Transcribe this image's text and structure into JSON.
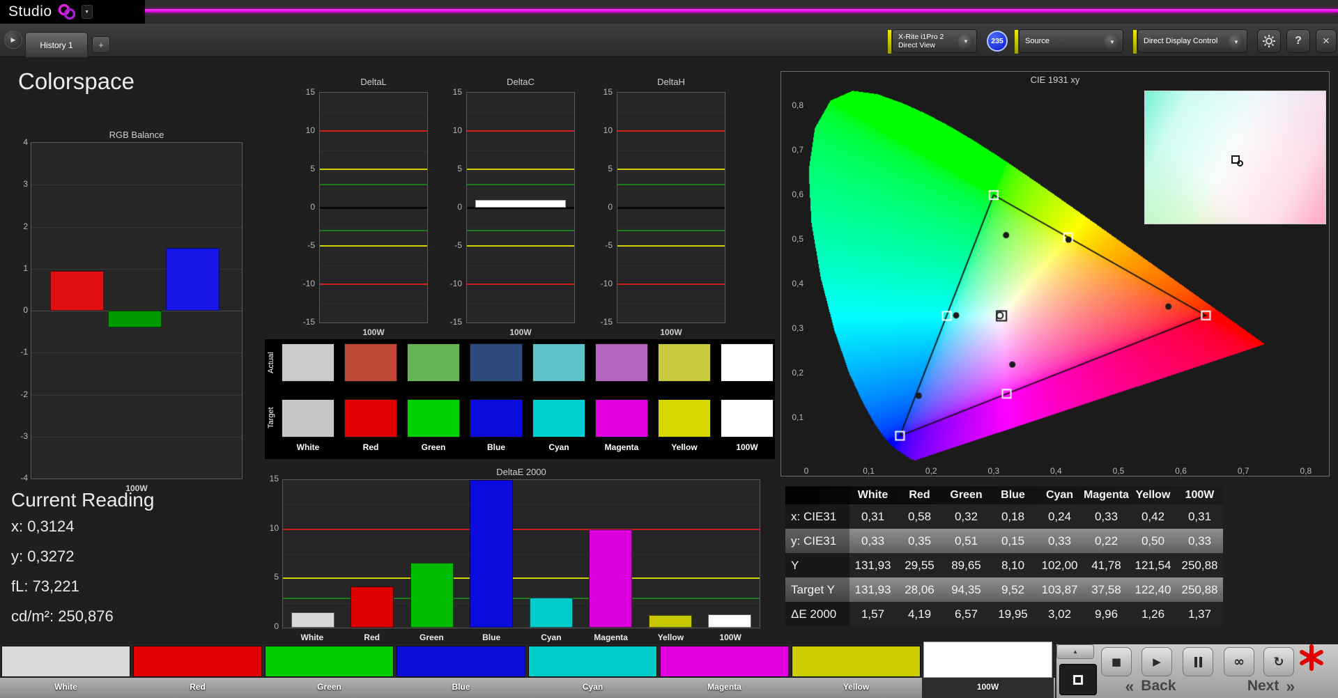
{
  "app": {
    "logo_text": "Studio",
    "accent_color": "#ff00ff"
  },
  "icons": {
    "dropdown_arrow": "▼",
    "expander": "▶",
    "caret": "▼",
    "add": "+",
    "close": "×",
    "help": "?",
    "up": "▲",
    "stop": "■",
    "play": "▶",
    "infinity": "∞",
    "refresh": "↻"
  },
  "tabbar": {
    "history_tab": "History 1"
  },
  "toolbar": {
    "meter_line1": "X-Rite i1Pro 2",
    "meter_line2": "Direct View",
    "meter_badge": "235",
    "source": "Source",
    "display_control": "Direct Display Control"
  },
  "page": {
    "title": "Colorspace"
  },
  "current_reading": {
    "title": "Current Reading",
    "lines": [
      "x: 0,3124",
      "y: 0,3272",
      "fL: 73,221",
      "cd/m²: 250,876"
    ]
  },
  "swatches": {
    "row_labels": [
      "Actual",
      "Target"
    ],
    "column_labels": [
      "White",
      "Red",
      "Green",
      "Blue",
      "Cyan",
      "Magenta",
      "Yellow",
      "100W"
    ],
    "actual_colors": [
      "#cacaca",
      "#c04838",
      "#66b358",
      "#2c4a7c",
      "#5ec2c8",
      "#b465bd",
      "#c9c93e",
      "#ffffff"
    ],
    "target_colors": [
      "#c6c6c6",
      "#e30000",
      "#00cf00",
      "#0b0bdf",
      "#00d0d0",
      "#e000e0",
      "#d6d600",
      "#ffffff"
    ]
  },
  "patch_bar": {
    "labels": [
      "White",
      "Red",
      "Green",
      "Blue",
      "Cyan",
      "Magenta",
      "Yellow",
      "100W"
    ],
    "colors": [
      "#d9d9d9",
      "#e00000",
      "#00cc00",
      "#0d0dda",
      "#00cccc",
      "#e000e0",
      "#cccc00",
      "#ffffff"
    ],
    "selected": "100W",
    "back_chevron": "«",
    "back_label": "Back",
    "next_label": "Next",
    "next_chevron": "»"
  },
  "chart_data": [
    {
      "type": "bar",
      "title": "RGB Balance",
      "xlabel": "100W",
      "categories": [
        "Red",
        "Green",
        "Blue"
      ],
      "values": [
        0.95,
        -0.4,
        1.5
      ],
      "colors": [
        "#e01010",
        "#009900",
        "#1515e8"
      ],
      "ylim": [
        -4,
        4
      ],
      "yticks": [
        4,
        3,
        2,
        1,
        0,
        -1,
        -2,
        -3,
        -4
      ]
    },
    {
      "type": "bar",
      "title": "DeltaL",
      "xlabel": "100W",
      "categories": [
        "100W"
      ],
      "values": [
        0
      ],
      "ylim": [
        -15,
        15
      ],
      "yticks": [
        15,
        10,
        5,
        0,
        -5,
        -10,
        -15
      ],
      "minor_gridlines": [
        12.5,
        7.5,
        2.5,
        -2.5,
        -7.5,
        -12.5
      ],
      "limit_lines": [
        {
          "value": 10,
          "color": "#d42020"
        },
        {
          "value": -10,
          "color": "#d42020"
        },
        {
          "value": 5,
          "color": "#d2d200"
        },
        {
          "value": -5,
          "color": "#d2d200"
        },
        {
          "value": 3,
          "color": "#1d7a1d"
        },
        {
          "value": -3,
          "color": "#1d7a1d"
        }
      ]
    },
    {
      "type": "bar",
      "title": "DeltaC",
      "xlabel": "100W",
      "categories": [
        "100W"
      ],
      "values": [
        1.0
      ],
      "ylim": [
        -15,
        15
      ],
      "yticks": [
        15,
        10,
        5,
        0,
        -5,
        -10,
        -15
      ],
      "minor_gridlines": [
        12.5,
        7.5,
        2.5,
        -2.5,
        -7.5,
        -12.5
      ],
      "limit_lines": [
        {
          "value": 10,
          "color": "#d42020"
        },
        {
          "value": -10,
          "color": "#d42020"
        },
        {
          "value": 5,
          "color": "#d2d200"
        },
        {
          "value": -5,
          "color": "#d2d200"
        },
        {
          "value": 3,
          "color": "#1d7a1d"
        },
        {
          "value": -3,
          "color": "#1d7a1d"
        }
      ]
    },
    {
      "type": "bar",
      "title": "DeltaH",
      "xlabel": "100W",
      "categories": [
        "100W"
      ],
      "values": [
        0
      ],
      "ylim": [
        -15,
        15
      ],
      "yticks": [
        15,
        10,
        5,
        0,
        -5,
        -10,
        -15
      ],
      "minor_gridlines": [
        12.5,
        7.5,
        2.5,
        -2.5,
        -7.5,
        -12.5
      ],
      "limit_lines": [
        {
          "value": 10,
          "color": "#d42020"
        },
        {
          "value": -10,
          "color": "#d42020"
        },
        {
          "value": 5,
          "color": "#d2d200"
        },
        {
          "value": -5,
          "color": "#d2d200"
        },
        {
          "value": 3,
          "color": "#1d7a1d"
        },
        {
          "value": -3,
          "color": "#1d7a1d"
        }
      ]
    },
    {
      "type": "bar",
      "title": "DeltaE 2000",
      "categories": [
        "White",
        "Red",
        "Green",
        "Blue",
        "Cyan",
        "Magenta",
        "Yellow",
        "100W"
      ],
      "values": [
        1.57,
        4.19,
        6.57,
        19.95,
        3.02,
        9.96,
        1.26,
        1.37
      ],
      "colors": [
        "#d8d8d8",
        "#dd0000",
        "#00bb00",
        "#0b0bdd",
        "#00cccc",
        "#dd00dd",
        "#c8c800",
        "#ffffff"
      ],
      "ylim": [
        0,
        15
      ],
      "yticks": [
        15,
        10,
        5,
        0
      ],
      "minor_gridlines": [
        12.5,
        7.5,
        2.5
      ],
      "limit_lines": [
        {
          "value": 10,
          "color": "#d42020"
        },
        {
          "value": 5,
          "color": "#d2d200"
        },
        {
          "value": 3,
          "color": "#1d7a1d"
        }
      ]
    },
    {
      "type": "scatter",
      "title": "CIE 1931 xy",
      "xlim": [
        0,
        0.8
      ],
      "ylim": [
        0,
        0.8
      ],
      "xtick_labels": [
        "0",
        "0,1",
        "0,2",
        "0,3",
        "0,4",
        "0,5",
        "0,6",
        "0,7",
        "0,8"
      ],
      "ytick_labels": [
        "0,1",
        "0,2",
        "0,3",
        "0,4",
        "0,5",
        "0,6",
        "0,7",
        "0,8"
      ],
      "gamut_triangle": [
        [
          0.64,
          0.33
        ],
        [
          0.3,
          0.6
        ],
        [
          0.15,
          0.06
        ]
      ],
      "targets": [
        {
          "name": "White",
          "x": 0.3127,
          "y": 0.329
        },
        {
          "name": "Red",
          "x": 0.64,
          "y": 0.33
        },
        {
          "name": "Green",
          "x": 0.3,
          "y": 0.6
        },
        {
          "name": "Blue",
          "x": 0.15,
          "y": 0.06
        },
        {
          "name": "Cyan",
          "x": 0.225,
          "y": 0.329
        },
        {
          "name": "Magenta",
          "x": 0.3209,
          "y": 0.1542
        },
        {
          "name": "Yellow",
          "x": 0.4193,
          "y": 0.5053
        }
      ],
      "measured": [
        {
          "name": "White",
          "x": 0.31,
          "y": 0.33
        },
        {
          "name": "Red",
          "x": 0.58,
          "y": 0.35
        },
        {
          "name": "Green",
          "x": 0.32,
          "y": 0.51
        },
        {
          "name": "Blue",
          "x": 0.18,
          "y": 0.15
        },
        {
          "name": "Cyan",
          "x": 0.24,
          "y": 0.33
        },
        {
          "name": "Magenta",
          "x": 0.33,
          "y": 0.22
        },
        {
          "name": "Yellow",
          "x": 0.42,
          "y": 0.5
        }
      ]
    },
    {
      "type": "table",
      "columns": [
        "",
        "White",
        "Red",
        "Green",
        "Blue",
        "Cyan",
        "Magenta",
        "Yellow",
        "100W"
      ],
      "rows": [
        [
          "x: CIE31",
          "0,31",
          "0,58",
          "0,32",
          "0,18",
          "0,24",
          "0,33",
          "0,42",
          "0,31"
        ],
        [
          "y: CIE31",
          "0,33",
          "0,35",
          "0,51",
          "0,15",
          "0,33",
          "0,22",
          "0,50",
          "0,33"
        ],
        [
          "Y",
          "131,93",
          "29,55",
          "89,65",
          "8,10",
          "102,00",
          "41,78",
          "121,54",
          "250,88"
        ],
        [
          "Target Y",
          "131,93",
          "28,06",
          "94,35",
          "9,52",
          "103,87",
          "37,58",
          "122,40",
          "250,88"
        ],
        [
          "ΔE 2000",
          "1,57",
          "4,19",
          "6,57",
          "19,95",
          "3,02",
          "9,96",
          "1,26",
          "1,37"
        ]
      ]
    }
  ]
}
